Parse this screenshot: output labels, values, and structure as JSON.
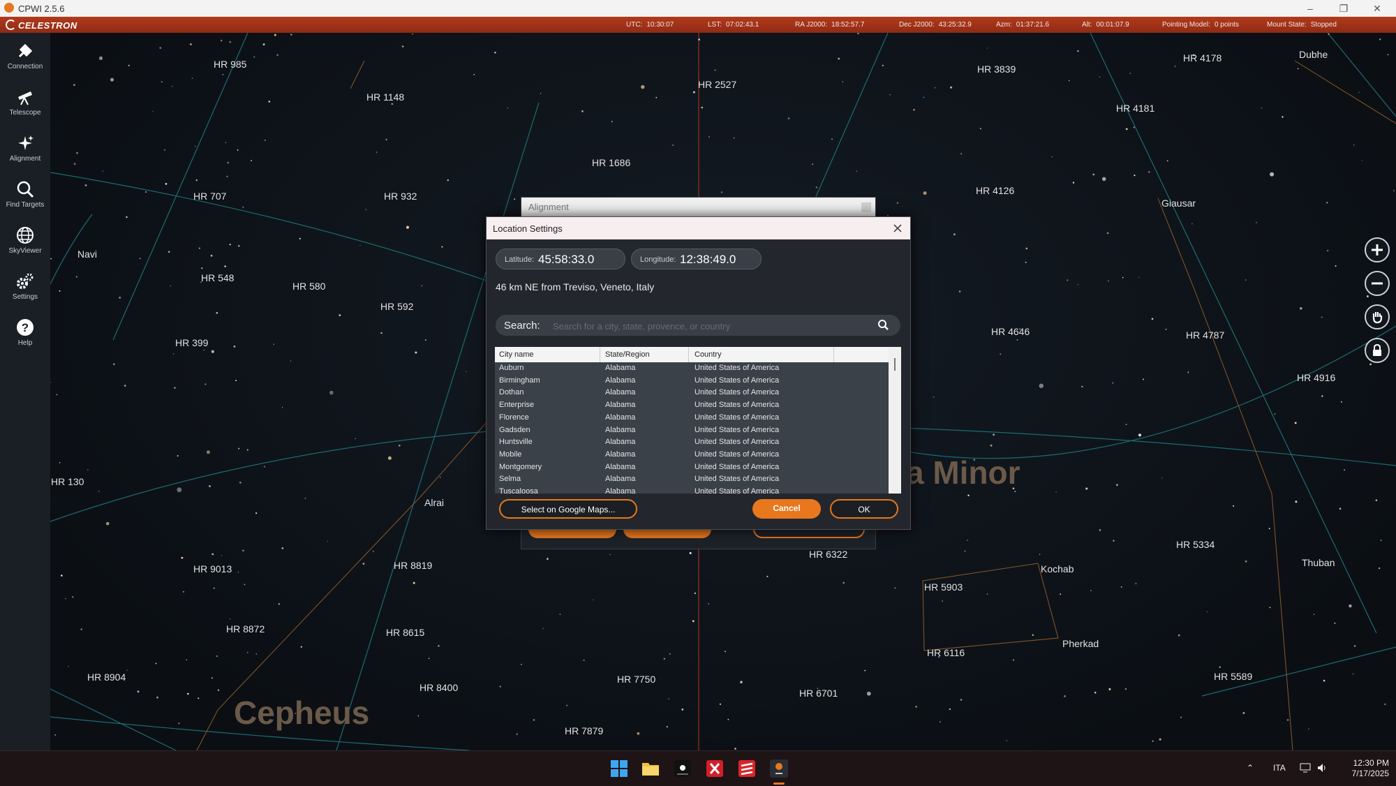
{
  "window": {
    "title": "CPWI 2.5.6",
    "brand": "CELESTRON"
  },
  "status": {
    "utc_label": "UTC:",
    "utc": "10:30:07",
    "lst_label": "LST:",
    "lst": "07:02:43.1",
    "ra_label": "RA J2000:",
    "ra": "18:52:57.7",
    "dec_label": "Dec J2000:",
    "dec": "43:25:32.9",
    "azm_label": "Azm:",
    "azm": "01:37:21.6",
    "alt_label": "Alt:",
    "alt": "00:01:07.9",
    "pointing_label": "Pointing Model:",
    "pointing": "0 points",
    "mount_label": "Mount State:",
    "mount": "Stopped"
  },
  "sidebar": [
    {
      "label": "Connection",
      "icon": "connection-icon"
    },
    {
      "label": "Telescope",
      "icon": "telescope-icon"
    },
    {
      "label": "Alignment",
      "icon": "sparkle-icon"
    },
    {
      "label": "Find Targets",
      "icon": "search-icon"
    },
    {
      "label": "SkyViewer",
      "icon": "globe-icon"
    },
    {
      "label": "Settings",
      "icon": "gear-icon"
    },
    {
      "label": "Help",
      "icon": "help-icon"
    }
  ],
  "stars": [
    "HR 985",
    "HR 1148",
    "HR 2527",
    "HR 3839",
    "HR 4178",
    "Dubhe",
    "HR 4181",
    "HR 1686",
    "HR 707",
    "HR 932",
    "HR 4126",
    "Giausar",
    "Navi",
    "HR 548",
    "HR 580",
    "HR 592",
    "HR 4646",
    "HR 4787",
    "HR 399",
    "HR 4916",
    "HR 130",
    "Alrai",
    "HR 5334",
    "HR 9013",
    "HR 8819",
    "HR 6322",
    "Kochab",
    "Thuban",
    "HR 5903",
    "HR 8872",
    "HR 8615",
    "Pherkad",
    "HR 6116",
    "HR 8904",
    "HR 7750",
    "HR 8400",
    "HR 6701",
    "HR 5589",
    "HR 7879"
  ],
  "constellations": [
    "Cepheus",
    "a Minor"
  ],
  "alignment_window": {
    "title": "Alignment"
  },
  "dialog": {
    "title": "Location Settings",
    "latitude_label": "Latitude:",
    "latitude": "45:58:33.0",
    "longitude_label": "Longitude:",
    "longitude": "12:38:49.0",
    "location_desc": "46 km NE from Treviso, Veneto, Italy",
    "search_label": "Search:",
    "search_placeholder": "Search for a city, state, provence, or country",
    "columns": [
      "City name",
      "State/Region",
      "Country"
    ],
    "rows": [
      [
        "Auburn",
        "Alabama",
        "United States of America"
      ],
      [
        "Birmingham",
        "Alabama",
        "United States of America"
      ],
      [
        "Dothan",
        "Alabama",
        "United States of America"
      ],
      [
        "Enterprise",
        "Alabama",
        "United States of America"
      ],
      [
        "Florence",
        "Alabama",
        "United States of America"
      ],
      [
        "Gadsden",
        "Alabama",
        "United States of America"
      ],
      [
        "Huntsville",
        "Alabama",
        "United States of America"
      ],
      [
        "Mobile",
        "Alabama",
        "United States of America"
      ],
      [
        "Montgomery",
        "Alabama",
        "United States of America"
      ],
      [
        "Selma",
        "Alabama",
        "United States of America"
      ],
      [
        "Tuscaloosa",
        "Alabama",
        "United States of America"
      ]
    ],
    "google_button": "Select on Google Maps...",
    "cancel_button": "Cancel",
    "ok_button": "OK"
  },
  "taskbar": {
    "lang": "ITA",
    "time": "12:30 PM",
    "date": "7/17/2025"
  },
  "colors": {
    "accent": "#e8771e",
    "statusbar": "#a3321a",
    "sky": "#0c1015"
  }
}
